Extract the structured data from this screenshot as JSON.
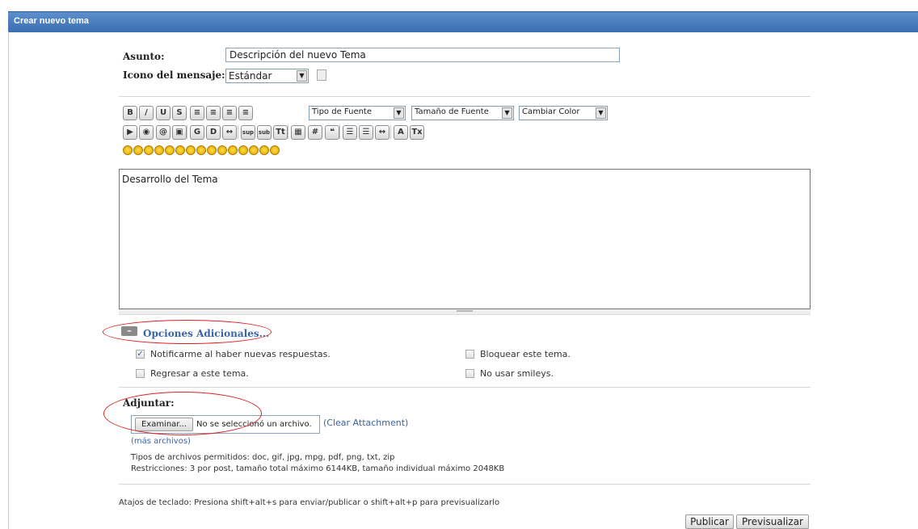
{
  "window": {
    "title": "Crear nuevo tema"
  },
  "form": {
    "subject_label": "Asunto:",
    "subject_value": "Descripción del nuevo Tema",
    "icon_label": "Icono del mensaje:",
    "icon_value": "Estándar"
  },
  "toolbar": {
    "font_select": "Tipo de Fuente",
    "size_select": "Tamaño de Fuente",
    "color_select": "Cambiar Color",
    "row1": [
      {
        "name": "bold-button",
        "g": "B"
      },
      {
        "name": "italic-button",
        "g": "/"
      },
      {
        "name": "underline-button",
        "g": "U"
      },
      {
        "name": "strikethrough-button",
        "g": "S"
      },
      {
        "name": "align-left-button",
        "g": "≡"
      },
      {
        "name": "align-right-button",
        "g": "≡"
      },
      {
        "name": "align-center-button",
        "g": "≡"
      },
      {
        "name": "align-justify-button",
        "g": "≡"
      }
    ],
    "row2": [
      {
        "name": "flash-button",
        "g": "▶"
      },
      {
        "name": "link-button",
        "g": "◉"
      },
      {
        "name": "email-button",
        "g": "@"
      },
      {
        "name": "image-button",
        "g": "▣"
      },
      {
        "name": "glow-button",
        "g": "G"
      },
      {
        "name": "shadow-button",
        "g": "D"
      },
      {
        "name": "move-button",
        "g": "↔"
      },
      {
        "name": "superscript-button",
        "g": "sup"
      },
      {
        "name": "subscript-button",
        "g": "sub"
      },
      {
        "name": "teletype-button",
        "g": "Tt"
      },
      {
        "name": "table-button",
        "g": "▦"
      },
      {
        "name": "code-button",
        "g": "#"
      },
      {
        "name": "quote-button",
        "g": "❝"
      },
      {
        "name": "bullet-list-button",
        "g": "☰"
      },
      {
        "name": "numbered-list-button",
        "g": "☰"
      },
      {
        "name": "horizontal-rule-button",
        "g": "↔"
      },
      {
        "name": "font-size-button",
        "g": "A"
      },
      {
        "name": "remove-format-button",
        "g": "Tx"
      }
    ],
    "smiley_count": 15
  },
  "editor": {
    "content": "Desarrollo del Tema"
  },
  "options": {
    "title": "Opciones Adicionales...",
    "notify": "Notificarme al haber nuevas respuestas.",
    "lock": "Bloquear este tema.",
    "return": "Regresar a este tema.",
    "no_smileys": "No usar smileys."
  },
  "attach": {
    "label": "Adjuntar:",
    "browse": "Examinar...",
    "no_file": "No se seleccionó un archivo.",
    "clear": "(Clear Attachment)",
    "more": "(más archivos)",
    "types": "Tipos de archivos permitidos: doc, gif, jpg, mpg, pdf, png, txt, zip",
    "limits": "Restricciones: 3 por post, tamaño total máximo 6144KB, tamaño individual máximo 2048KB"
  },
  "footer": {
    "shortcuts": "Atajos de teclado: Presiona shift+alt+s para enviar/publicar o shift+alt+p para previsualizarlo",
    "publish": "Publicar",
    "preview": "Previsualizar"
  },
  "colors": {
    "title_bar": "#3b6eb3",
    "link": "#3a64a8",
    "annotation": "#dd2222"
  }
}
